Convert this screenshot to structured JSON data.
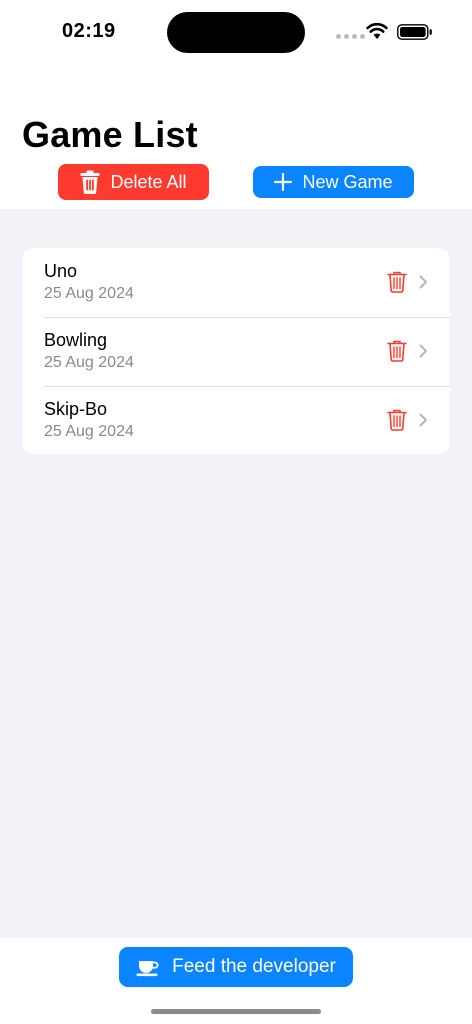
{
  "status_bar": {
    "time": "02:19"
  },
  "header": {
    "title": "Game List",
    "delete_all_label": "Delete All",
    "new_game_label": "New Game"
  },
  "games": [
    {
      "name": "Uno",
      "date": "25 Aug 2024"
    },
    {
      "name": "Bowling",
      "date": "25 Aug 2024"
    },
    {
      "name": "Skip-Bo",
      "date": "25 Aug 2024"
    }
  ],
  "footer": {
    "feed_label": "Feed the developer"
  },
  "colors": {
    "accent_blue": "#0A84FF",
    "destructive_red": "#FF3B30",
    "background": "#F2F2F7"
  },
  "icons": [
    "trash-icon",
    "plus-icon",
    "chevron-right-icon",
    "coffee-cup-icon",
    "wifi-icon",
    "battery-icon"
  ]
}
